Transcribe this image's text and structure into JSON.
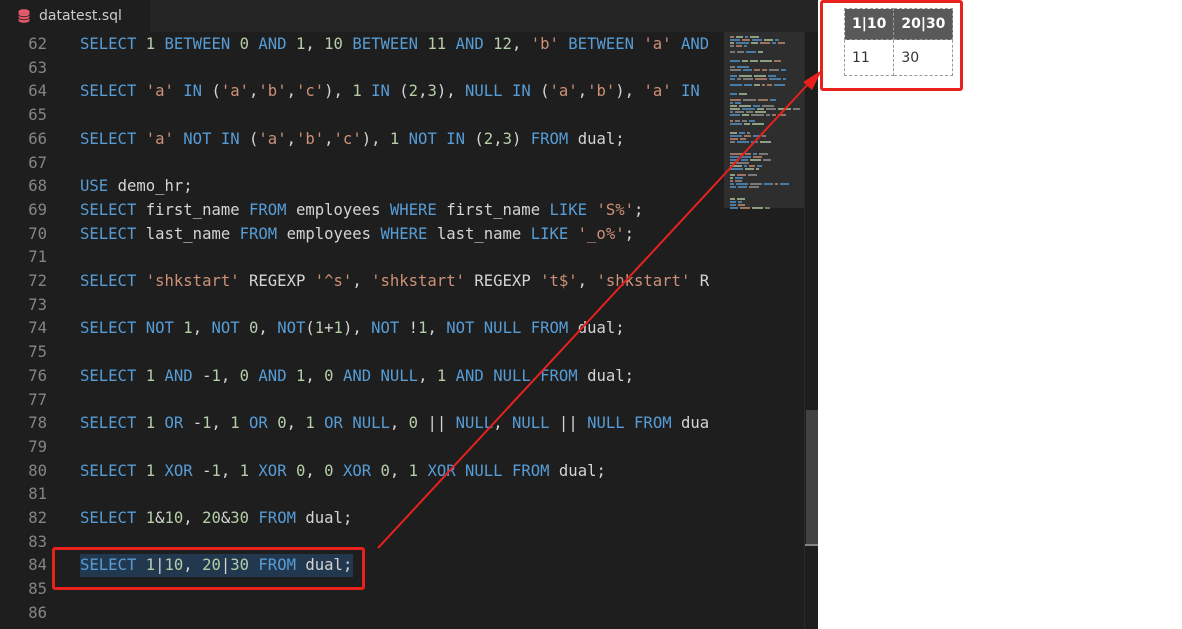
{
  "tab": {
    "title": "datatest.sql",
    "icon": "database-icon"
  },
  "editor": {
    "lines": [
      {
        "num": "62",
        "code": "SELECT 1 BETWEEN 0 AND 1, 10 BETWEEN 11 AND 12, 'b' BETWEEN 'a' AND"
      },
      {
        "num": "63",
        "code": ""
      },
      {
        "num": "64",
        "code": "SELECT 'a' IN ('a','b','c'), 1 IN (2,3), NULL IN ('a','b'), 'a' IN"
      },
      {
        "num": "65",
        "code": ""
      },
      {
        "num": "66",
        "code": "SELECT 'a' NOT IN ('a','b','c'), 1 NOT IN (2,3) FROM dual;"
      },
      {
        "num": "67",
        "code": ""
      },
      {
        "num": "68",
        "code": "USE demo_hr;"
      },
      {
        "num": "69",
        "code": "SELECT first_name FROM employees WHERE first_name LIKE 'S%';"
      },
      {
        "num": "70",
        "code": "SELECT last_name FROM employees WHERE last_name LIKE '_o%';"
      },
      {
        "num": "71",
        "code": ""
      },
      {
        "num": "72",
        "code": "SELECT 'shkstart' REGEXP '^s', 'shkstart' REGEXP 't$', 'shkstart' R"
      },
      {
        "num": "73",
        "code": ""
      },
      {
        "num": "74",
        "code": "SELECT NOT 1, NOT 0, NOT(1+1), NOT !1, NOT NULL FROM dual;"
      },
      {
        "num": "75",
        "code": ""
      },
      {
        "num": "76",
        "code": "SELECT 1 AND -1, 0 AND 1, 0 AND NULL, 1 AND NULL FROM dual;"
      },
      {
        "num": "77",
        "code": ""
      },
      {
        "num": "78",
        "code": "SELECT 1 OR -1, 1 OR 0, 1 OR NULL, 0 || NULL, NULL || NULL FROM dua"
      },
      {
        "num": "79",
        "code": ""
      },
      {
        "num": "80",
        "code": "SELECT 1 XOR -1, 1 XOR 0, 0 XOR 0, 1 XOR NULL FROM dual;"
      },
      {
        "num": "81",
        "code": ""
      },
      {
        "num": "82",
        "code": "SELECT 1&10, 20&30 FROM dual;"
      },
      {
        "num": "83",
        "code": ""
      },
      {
        "num": "84",
        "code": "SELECT 1|10, 20|30 FROM dual;"
      },
      {
        "num": "85",
        "code": ""
      },
      {
        "num": "86",
        "code": ""
      }
    ],
    "highlighted_line": "84"
  },
  "results": {
    "columns": [
      "1|10",
      "20|30"
    ],
    "rows": [
      [
        "11",
        "30"
      ]
    ]
  },
  "colors": {
    "background": "#1e1e1e",
    "keyword": "#569cd6",
    "string": "#ce9178",
    "number": "#b5cea8",
    "annotation": "#e8211d",
    "header_bg": "#595959"
  }
}
